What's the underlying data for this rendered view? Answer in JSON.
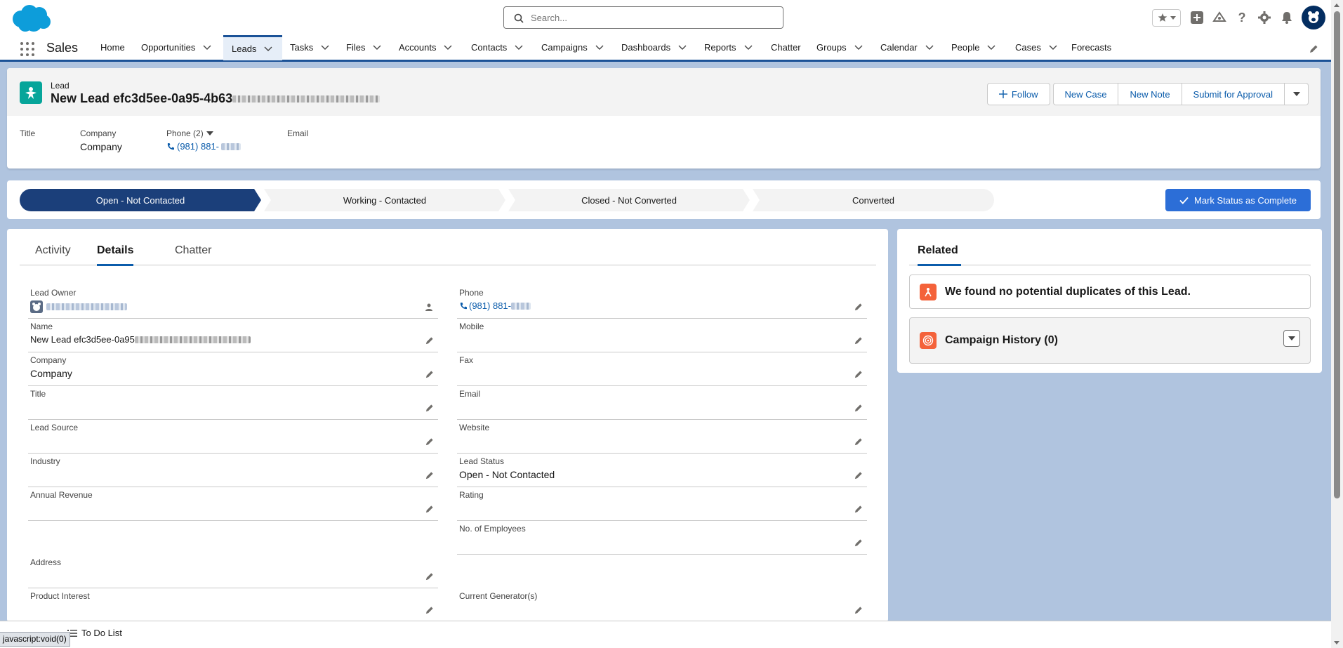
{
  "header": {
    "search_placeholder": "Search...",
    "icons": [
      "salesforce-cloud-logo",
      "favorites-star-icon",
      "global-add-icon",
      "trailhead-icon",
      "help-icon",
      "setup-gear-icon",
      "notifications-bell-icon",
      "user-avatar-icon"
    ]
  },
  "nav": {
    "app_name": "Sales",
    "tabs": [
      "Home",
      "Opportunities",
      "Leads",
      "Tasks",
      "Files",
      "Accounts",
      "Contacts",
      "Campaigns",
      "Dashboards",
      "Reports",
      "Chatter",
      "Groups",
      "Calendar",
      "People",
      "Cases",
      "Forecasts"
    ],
    "active_tab": "Leads"
  },
  "record": {
    "object_label": "Lead",
    "title": "New Lead efc3d5ee-0a95-4b63",
    "buttons": {
      "follow": "Follow",
      "new_case": "New Case",
      "new_note": "New Note",
      "submit": "Submit for Approval"
    },
    "highlights": {
      "title_label": "Title",
      "company_label": "Company",
      "company_value": "Company",
      "phone_label": "Phone (2)",
      "phone_value": "(981) 881-",
      "email_label": "Email"
    }
  },
  "path": {
    "steps": [
      "Open - Not Contacted",
      "Working - Contacted",
      "Closed - Not Converted",
      "Converted"
    ],
    "current": "Open - Not Contacted",
    "complete_button": "Mark Status as Complete"
  },
  "details": {
    "tabs": [
      "Activity",
      "Details",
      "Chatter"
    ],
    "active_tab": "Details",
    "left": {
      "lead_owner_label": "Lead Owner",
      "name_label": "Name",
      "name_value": "New Lead efc3d5ee-0a95",
      "company_label": "Company",
      "company_value": "Company",
      "title_label": "Title",
      "lead_source_label": "Lead Source",
      "industry_label": "Industry",
      "annual_revenue_label": "Annual Revenue",
      "address_label": "Address",
      "product_interest_label": "Product Interest"
    },
    "right": {
      "phone_label": "Phone",
      "phone_value": "(981) 881-",
      "mobile_label": "Mobile",
      "fax_label": "Fax",
      "email_label": "Email",
      "website_label": "Website",
      "lead_status_label": "Lead Status",
      "lead_status_value": "Open - Not Contacted",
      "rating_label": "Rating",
      "employees_label": "No. of Employees",
      "generators_label": "Current Generator(s)"
    }
  },
  "related": {
    "tab": "Related",
    "duplicates": "We found no potential duplicates of this Lead.",
    "campaign_history": "Campaign History (0)"
  },
  "utility": {
    "to_do": "To Do List",
    "status_url": "javascript:void(0)"
  },
  "colors": {
    "brand_blue": "#0b5cab",
    "path_current": "#1b3f7a",
    "primary_button": "#2c6ed7",
    "lead_icon": "#06a59a",
    "related_icon": "#f4623a"
  }
}
